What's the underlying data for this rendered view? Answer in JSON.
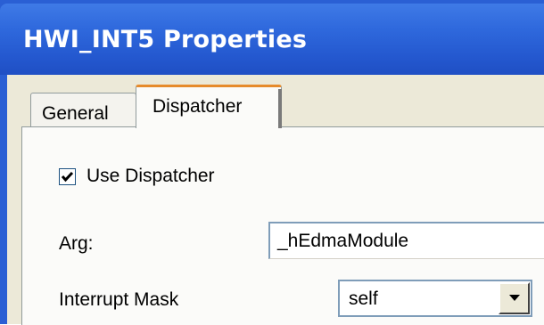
{
  "window": {
    "title": "HWI_INT5 Properties"
  },
  "tabs": [
    {
      "label": "General",
      "selected": false
    },
    {
      "label": "Dispatcher",
      "selected": true
    }
  ],
  "dispatcher": {
    "use_dispatcher": {
      "label": "Use Dispatcher",
      "checked": true
    },
    "arg": {
      "label": "Arg:",
      "value": "_hEdmaModule"
    },
    "interrupt_mask": {
      "label": "Interrupt Mask",
      "value": "self"
    }
  },
  "icons": {
    "checkbox_mark": "check-icon",
    "dropdown": "chevron-down-icon"
  },
  "colors": {
    "titlebar": "#2458cf",
    "dialog_bg": "#ece9d8",
    "selected_tab_accent": "#e68b2c",
    "input_border": "#7f9db9"
  }
}
